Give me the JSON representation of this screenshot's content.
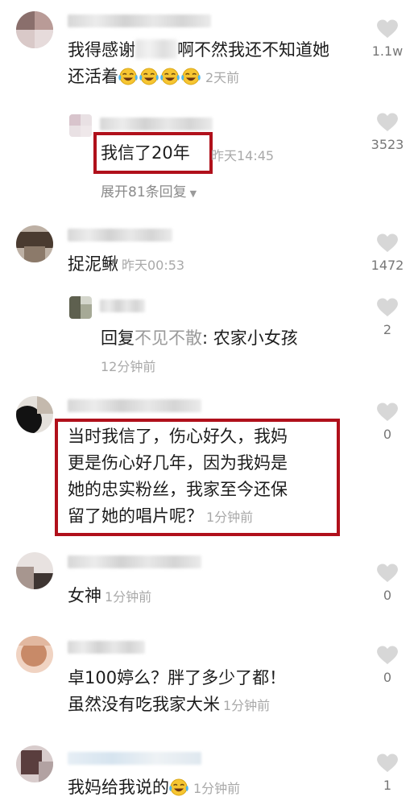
{
  "comments": [
    {
      "text_before": "我得感谢",
      "text_after": "啊不然我还不知道她还活着",
      "time": "2天前",
      "likes": "1.1w",
      "emoji_name": "laugh-cry-emoji"
    },
    {
      "text": "我信了20年",
      "time": "昨天14:45",
      "likes": "3523",
      "expand_label": "展开81条回复"
    },
    {
      "text": "捉泥鳅",
      "time": "昨天00:53",
      "likes": "1472"
    },
    {
      "reply_prefix": "回复",
      "reply_gray": "不见不散",
      "reply_text": ": 农家小女孩",
      "time": "12分钟前",
      "likes": "2"
    },
    {
      "line1": "当时我信了，伤心好久，我妈",
      "line2": "更是伤心好几年，因为我妈是",
      "line3": "她的忠实粉丝，我家至今还保",
      "line4": "留了她的唱片呢？",
      "time": "1分钟前",
      "likes": "0"
    },
    {
      "text": "女神",
      "time": "1分钟前",
      "likes": "0"
    },
    {
      "line1": "卓100婷么？胖了多少了都！",
      "line2": "虽然没有吃我家大米",
      "time": "1分钟前",
      "likes": "0"
    },
    {
      "text": "我妈给我说的",
      "time": "1分钟前",
      "likes": "1",
      "emoji_name": "laugh-cry-emoji"
    }
  ],
  "colors": {
    "highlight_border": "#b0101b",
    "timestamp": "#a9a9a9",
    "text": "#1c1c1c"
  }
}
